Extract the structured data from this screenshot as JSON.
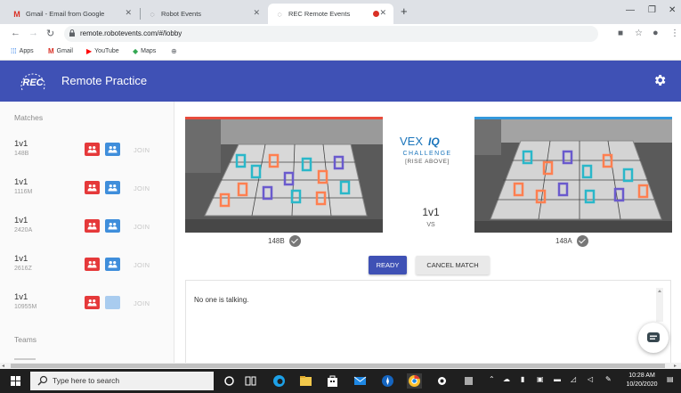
{
  "browser": {
    "tabs": [
      {
        "label": "Gmail - Email from Google",
        "icon": "gmail-icon"
      },
      {
        "label": "Robot Events",
        "icon": "loading-icon"
      },
      {
        "label": "REC Remote Events",
        "icon": "loading-icon",
        "active": true
      }
    ],
    "new_tab": "+",
    "url": "remote.robotevents.com/#/lobby",
    "bookmarks": [
      {
        "label": "Apps",
        "icon": "apps-grid-icon"
      },
      {
        "label": "Gmail",
        "icon": "gmail-icon"
      },
      {
        "label": "YouTube",
        "icon": "youtube-icon"
      },
      {
        "label": "Maps",
        "icon": "maps-icon"
      },
      {
        "label": "",
        "icon": "globe-icon"
      }
    ]
  },
  "header": {
    "title": "Remote Practice",
    "logo_text": "REC",
    "color": "#3f51b5"
  },
  "sidebar": {
    "matches_heading": "Matches",
    "matches": [
      {
        "type": "1v1",
        "team": "148B",
        "join": "JOIN",
        "second_slot_filled": true
      },
      {
        "type": "1v1",
        "team": "1116M",
        "join": "JOIN",
        "second_slot_filled": true
      },
      {
        "type": "1v1",
        "team": "2420A",
        "join": "JOIN",
        "second_slot_filled": true
      },
      {
        "type": "1v1",
        "team": "2616Z",
        "join": "JOIN",
        "second_slot_filled": true
      },
      {
        "type": "1v1",
        "team": "10955M",
        "join": "JOIN",
        "second_slot_filled": false
      }
    ],
    "teams_heading": "Teams"
  },
  "match": {
    "left_team": "148B",
    "right_team": "148A",
    "type": "1v1",
    "vs": "VS",
    "left_color": "#e74c3c",
    "right_color": "#3498db",
    "vex_logo": {
      "brand": "VEX",
      "suffix": "IQ",
      "line1": "CHALLENGE",
      "line2": "[RISE ABOVE]"
    },
    "ready_label": "READY",
    "cancel_label": "CANCEL MATCH"
  },
  "chat": {
    "message": "No one is talking."
  },
  "taskbar": {
    "search_placeholder": "Type here to search",
    "time": "10:28 AM",
    "date": "10/20/2020"
  }
}
